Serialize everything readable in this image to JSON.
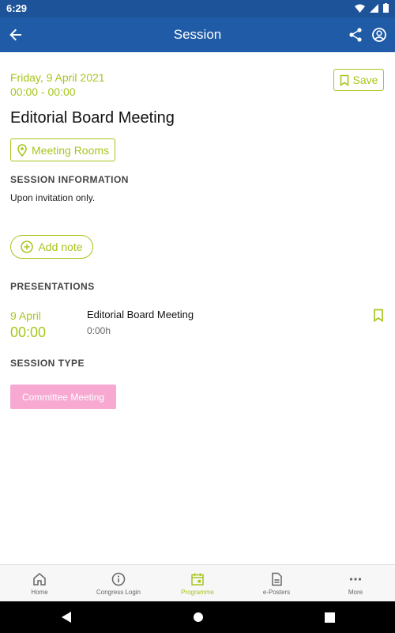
{
  "status_bar": {
    "time": "6:29"
  },
  "app_bar": {
    "title": "Session"
  },
  "session": {
    "date": "Friday, 9 April 2021",
    "time": "00:00 - 00:00",
    "save_label": "Save",
    "title": "Editorial Board Meeting",
    "rooms_label": "Meeting Rooms"
  },
  "info": {
    "heading": "SESSION INFORMATION",
    "text": "Upon invitation only."
  },
  "add_note_label": "Add note",
  "presentations": {
    "heading": "PRESENTATIONS",
    "items": [
      {
        "date": "9 April",
        "time": "00:00",
        "title": "Editorial Board Meeting",
        "duration": "0:00h"
      }
    ]
  },
  "session_type": {
    "heading": "SESSION TYPE",
    "badge": "Committee Meeting"
  },
  "bottom_nav": {
    "items": [
      {
        "label": "Home",
        "icon": "home-icon"
      },
      {
        "label": "Congress Login",
        "icon": "info-icon"
      },
      {
        "label": "Programme",
        "icon": "calendar-icon",
        "active": true
      },
      {
        "label": "e-Posters",
        "icon": "document-icon"
      },
      {
        "label": "More",
        "icon": "more-icon"
      }
    ]
  },
  "colors": {
    "primary": "#1f5ba6",
    "accent": "#a6c61c",
    "badge": "#f7a9d2"
  }
}
